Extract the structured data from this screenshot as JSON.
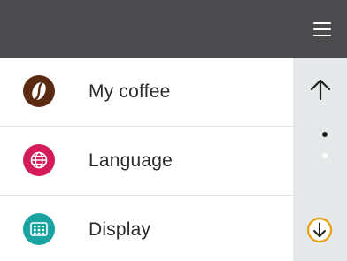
{
  "header": {
    "menu_icon": "hamburger-menu-icon",
    "background": "#4b4b4d"
  },
  "menu": {
    "items": [
      {
        "label": "My coffee",
        "icon": "coffee-bean-icon",
        "color": "#5a2a12"
      },
      {
        "label": "Language",
        "icon": "globe-icon",
        "color": "#d41c5c"
      },
      {
        "label": "Display",
        "icon": "display-icon",
        "color": "#1aa3a0"
      }
    ]
  },
  "scroll": {
    "up_icon": "arrow-up-icon",
    "down_icon": "arrow-down-circle-icon",
    "pages": 2,
    "current_page": 1,
    "accent": "#e8a317"
  }
}
